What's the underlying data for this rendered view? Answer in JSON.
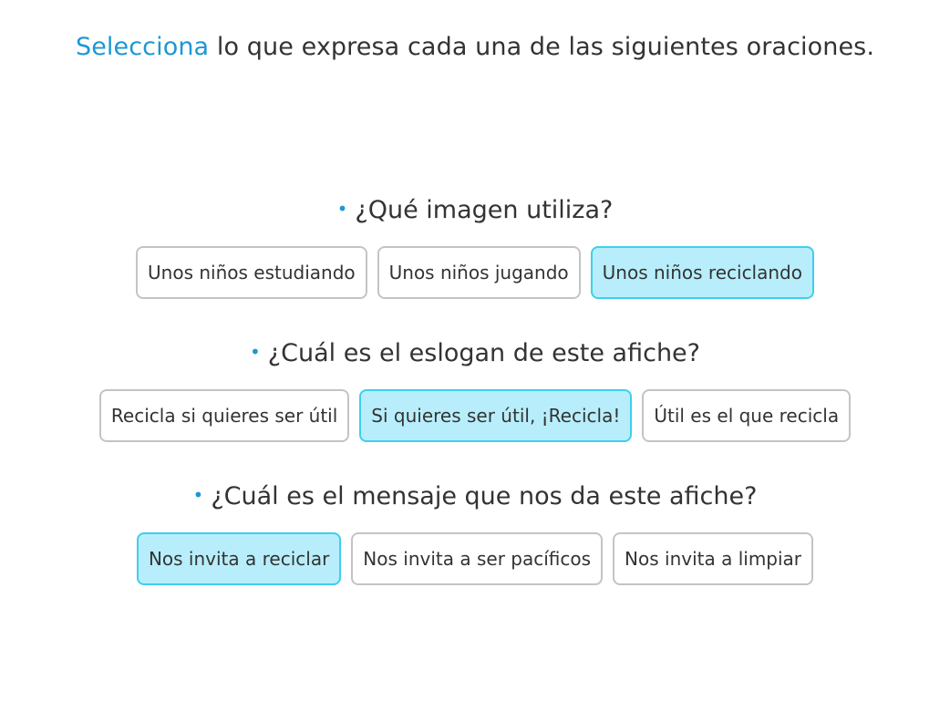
{
  "instruction": {
    "highlight": "Selecciona",
    "rest": " lo que expresa cada una de las siguientes oraciones."
  },
  "colors": {
    "accent": "#1d97d5",
    "selected_bg": "#b8eefc",
    "selected_border": "#3fcfec",
    "unselected_border": "#c4c4c4"
  },
  "questions": [
    {
      "text": "¿Qué imagen utiliza?",
      "options": [
        {
          "label": "Unos niños estudiando",
          "selected": false
        },
        {
          "label": "Unos niños jugando",
          "selected": false
        },
        {
          "label": "Unos niños reciclando",
          "selected": true
        }
      ]
    },
    {
      "text": "¿Cuál es el eslogan de este afiche?",
      "options": [
        {
          "label": "Recicla si quieres ser útil",
          "selected": false
        },
        {
          "label": "Si quieres ser útil, ¡Recicla!",
          "selected": true
        },
        {
          "label": "Útil es el que recicla",
          "selected": false
        }
      ]
    },
    {
      "text": "¿Cuál es el mensaje que nos da este afiche?",
      "options": [
        {
          "label": "Nos invita a reciclar",
          "selected": true
        },
        {
          "label": "Nos invita a ser pacíficos",
          "selected": false
        },
        {
          "label": "Nos invita a limpiar",
          "selected": false
        }
      ]
    }
  ]
}
